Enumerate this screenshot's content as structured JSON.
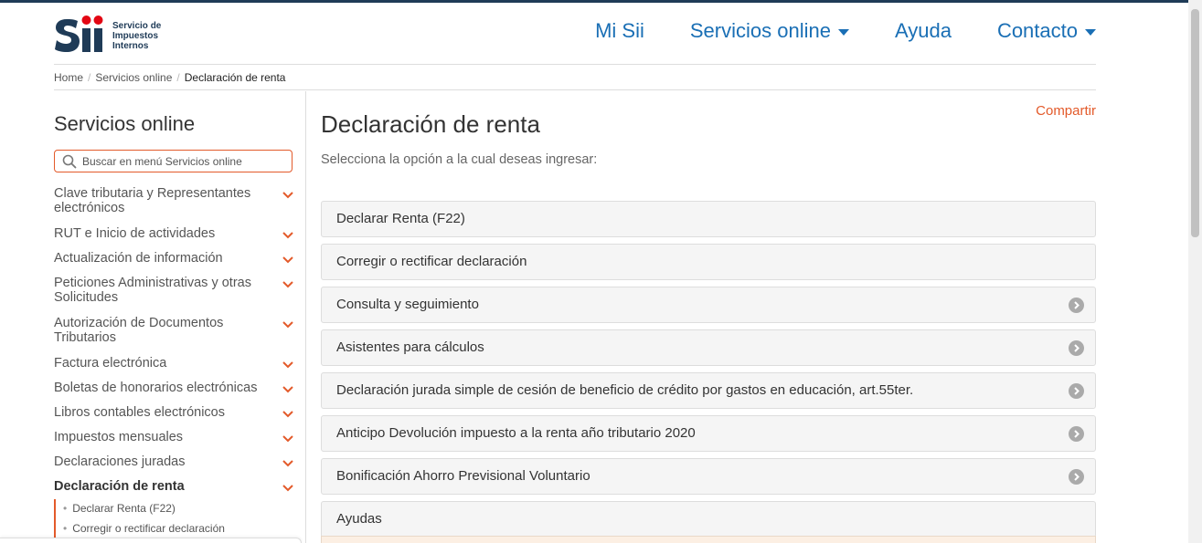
{
  "header": {
    "logo_text_1": "Servicio de",
    "logo_text_2": "Impuestos",
    "logo_text_3": "Internos",
    "nav": [
      {
        "label": "Mi Sii"
      },
      {
        "label": "Servicios online"
      },
      {
        "label": "Ayuda"
      },
      {
        "label": "Contacto"
      }
    ]
  },
  "breadcrumb": {
    "home": "Home",
    "sep": "/",
    "services": "Servicios online",
    "current": "Declaración de renta"
  },
  "sidebar": {
    "title": "Servicios online",
    "search_placeholder": "Buscar en menú Servicios online",
    "items": [
      {
        "label": "Clave tributaria y Representantes electrónicos"
      },
      {
        "label": "RUT e Inicio de actividades"
      },
      {
        "label": "Actualización de información"
      },
      {
        "label": "Peticiones Administrativas y otras Solicitudes"
      },
      {
        "label": "Autorización de Documentos Tributarios"
      },
      {
        "label": "Factura electrónica"
      },
      {
        "label": "Boletas de honorarios electrónicas"
      },
      {
        "label": "Libros contables electrónicos"
      },
      {
        "label": "Impuestos mensuales"
      },
      {
        "label": "Declaraciones juradas"
      },
      {
        "label": "Declaración de renta"
      }
    ],
    "subitems": [
      {
        "label": "Declarar Renta (F22)"
      },
      {
        "label": "Corregir o rectificar declaración"
      }
    ]
  },
  "main": {
    "title": "Declaración de renta",
    "share": "Compartir",
    "subtitle": "Selecciona la opción a la cual deseas ingresar:",
    "options": [
      {
        "label": "Declarar Renta (F22)"
      },
      {
        "label": "Corregir o rectificar declaración"
      },
      {
        "label": "Consulta y seguimiento"
      },
      {
        "label": "Asistentes para cálculos"
      },
      {
        "label": "Declaración jurada simple de cesión de beneficio de crédito por gastos en educación, art.55ter."
      },
      {
        "label": "Anticipo Devolución impuesto a la renta año tributario 2020"
      },
      {
        "label": "Bonificación Ahorro Previsional Voluntario"
      },
      {
        "label": "Ayudas"
      }
    ]
  },
  "colors": {
    "brand_blue": "#1f3b57",
    "link_blue": "#1a6fb5",
    "accent_orange": "#e35a2a",
    "logo_red": "#e30613"
  }
}
